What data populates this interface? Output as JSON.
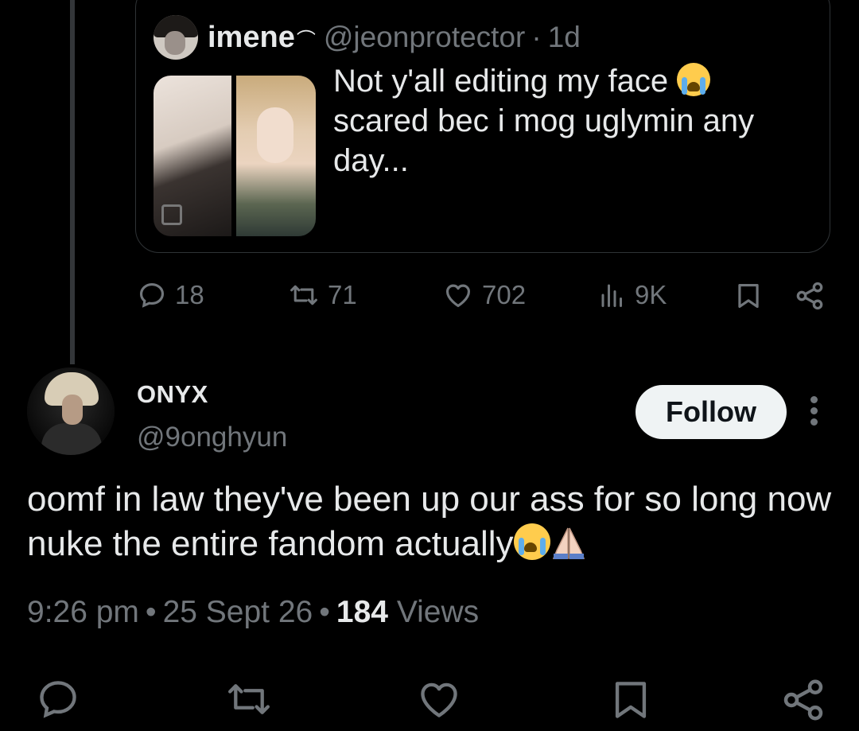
{
  "quoted_tweet": {
    "author_name": "imene",
    "name_symbol": "⌒",
    "handle": "@jeonprotector",
    "separator": "·",
    "time": "1d",
    "text_main": "Not y'all editing my face ",
    "text_rest": "scared bec i mog uglymin any day...",
    "stats": {
      "replies": "18",
      "reposts": "71",
      "likes": "702",
      "views": "9K"
    }
  },
  "tweet": {
    "author_name": "ONYX",
    "handle": "@9onghyun",
    "follow_label": "Follow",
    "text": "oomf in law they've been up our ass for so long now nuke the entire fandom actually",
    "time": "9:26 pm",
    "date": "25 Sept 26",
    "views_count": "184",
    "views_label": "Views",
    "meta_sep": "•"
  },
  "icons": {
    "reply": "reply-icon",
    "repost": "repost-icon",
    "like": "heart-icon",
    "views": "views-icon",
    "bookmark": "bookmark-icon",
    "share": "share-icon",
    "more": "more-icon"
  },
  "colors": {
    "background": "#000000",
    "text": "#e7e9ea",
    "muted": "#71767b",
    "border": "#2f3336",
    "follow_bg": "#eff3f4"
  }
}
